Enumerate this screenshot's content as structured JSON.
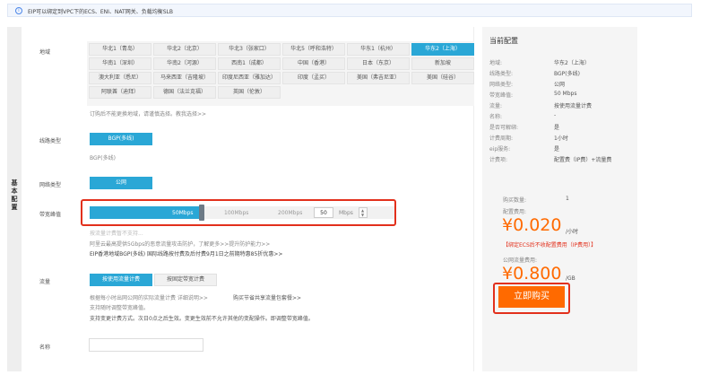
{
  "notice": {
    "text": "EIP可以绑定到VPC下的ECS、ENI、NAT网关、负载均衡SLB",
    "icon": "info-icon"
  },
  "sidebar": {
    "title": "基本配置"
  },
  "labels": {
    "region": "地域",
    "line": "线路类型",
    "network": "网络类型",
    "bandwidth": "带宽峰值",
    "traffic": "流量",
    "name": "名称"
  },
  "regions": [
    [
      "华北1（青岛）",
      "华北2（北京）",
      "华北3（张家口）",
      "华北5（呼和浩特）",
      "华东1（杭州）",
      "华东2（上海）"
    ],
    [
      "华南1（深圳）",
      "华南2（河源）",
      "西南1（成都）",
      "中国（香港）",
      "日本（东京）",
      "新加坡"
    ],
    [
      "澳大利亚（悉尼）",
      "马来西亚（吉隆坡）",
      "印度尼西亚（雅加达）",
      "印度（孟买）",
      "美国（弗吉尼亚）",
      "美国（硅谷）"
    ],
    [
      "阿联酋（迪拜）",
      "德国（法兰克福）",
      "英国（伦敦）"
    ]
  ],
  "region_hint": "订购后不能更换地域，请谨慎选择。教我选择>>",
  "line": {
    "button": "BGP(多线)",
    "sub": "BGP(多线)"
  },
  "network": {
    "button": "公网"
  },
  "bandwidth": {
    "ticks": [
      "50Mbps",
      "100Mbps",
      "200Mbps"
    ],
    "value": "50",
    "unit": "Mbps",
    "fill_fraction": 0.25,
    "note1": "按流量计费暂不支持...",
    "note2": "阿里云最高提供5Gbps的恶意流量攻击防护，了解更多>>提升防护能力>>",
    "note3": "EIP香港地域BGP(多线) 国际线路按付费及后付费9月1日之前期特惠85折优惠>>"
  },
  "traffic": {
    "opt1": "按使用流量计费",
    "opt2": "按固定带宽计费",
    "hint1": "根据每小时出网公网的实际流量计费 详细说明>>",
    "hint1b": "购买节省共享流量包套餐>>",
    "hint2": "支持随时调整带宽峰值。",
    "hint3": "支持变更计费方式。次日0点之后生效。变更生效前不允许其他的变配操作。即调整带宽峰值。"
  },
  "summary": {
    "title": "当前配置",
    "rows": [
      {
        "k": "地域:",
        "v": "华东2（上海）"
      },
      {
        "k": "线路类型:",
        "v": "BGP(多线)"
      },
      {
        "k": "网络类型:",
        "v": "公网"
      },
      {
        "k": "带宽峰值:",
        "v": "50 Mbps"
      },
      {
        "k": "流量:",
        "v": "按使用流量计费"
      },
      {
        "k": "名称:",
        "v": "-"
      },
      {
        "k": "是否可解绑:",
        "v": "是"
      },
      {
        "k": "计费周期:",
        "v": "1小时"
      },
      {
        "k": "eip服务:",
        "v": "是"
      },
      {
        "k": "计费项:",
        "v": "配置费（IP费）+流量费"
      }
    ],
    "qty_label": "购买数量:",
    "qty": "1",
    "config_fee_label": "配置费用:",
    "config_price": "¥0.020",
    "config_unit": "/小时",
    "warning": "【绑定ECS后不收配置费用（IP费用）】",
    "traffic_fee_label": "公网流量费用:",
    "traffic_price": "¥0.800",
    "traffic_unit": "/GB",
    "buy": "立即购买"
  },
  "colors": {
    "accent": "#2aa7d6",
    "orange": "#ff6a00",
    "highlight": "#e2301c"
  }
}
